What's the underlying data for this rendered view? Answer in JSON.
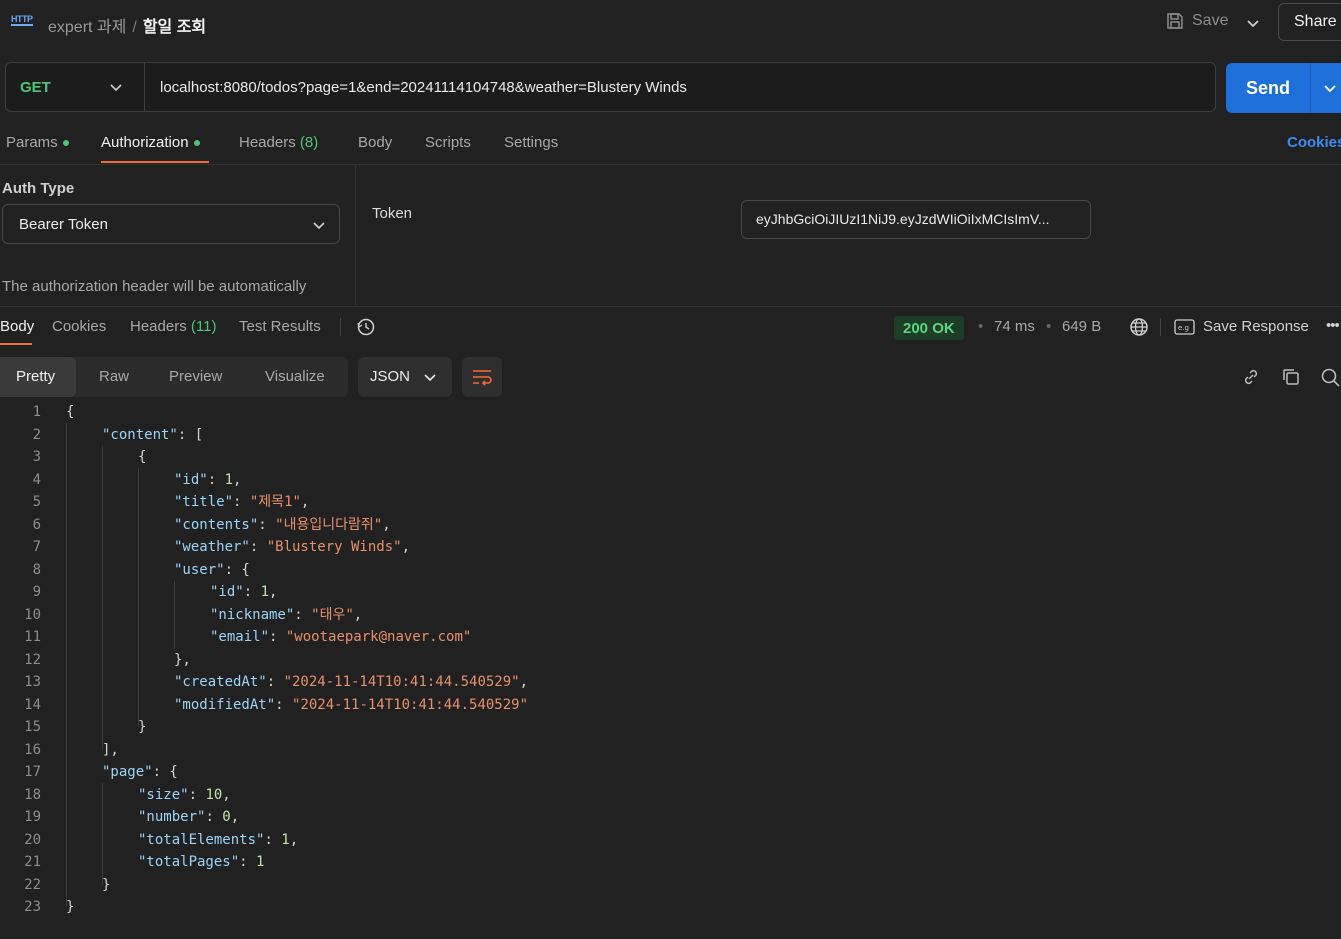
{
  "header": {
    "breadcrumb_collection": "expert 과제",
    "breadcrumb_separator": "/",
    "breadcrumb_request": "할일 조회",
    "save_label": "Save",
    "share_label": "Share"
  },
  "request": {
    "method": "GET",
    "url": "localhost:8080/todos?page=1&end=20241114104748&weather=Blustery Winds",
    "send_label": "Send"
  },
  "request_tabs": {
    "params": "Params",
    "authorization": "Authorization",
    "headers": "Headers",
    "headers_count": "(8)",
    "body": "Body",
    "scripts": "Scripts",
    "settings": "Settings",
    "cookies": "Cookies"
  },
  "auth": {
    "type_label": "Auth Type",
    "type_value": "Bearer Token",
    "note": "The authorization header will be automatically",
    "token_label": "Token",
    "token_value": "eyJhbGciOiJIUzI1NiJ9.eyJzdWIiOiIxMCIsImV..."
  },
  "response_tabs": {
    "body": "Body",
    "cookies": "Cookies",
    "headers": "Headers",
    "headers_count": "(11)",
    "test_results": "Test Results"
  },
  "response_meta": {
    "status": "200 OK",
    "time": "74 ms",
    "size": "649 B",
    "save_response": "Save Response",
    "status_color": "#5bd47f"
  },
  "view": {
    "pretty": "Pretty",
    "raw": "Raw",
    "preview": "Preview",
    "visualize": "Visualize",
    "format": "JSON"
  },
  "code_lines": [
    {
      "n": "1",
      "t": [
        [
          "p",
          "{"
        ]
      ]
    },
    {
      "n": "2",
      "t": [
        [
          "k",
          "\"content\""
        ],
        [
          "p",
          ": ["
        ]
      ]
    },
    {
      "n": "3",
      "t": [
        [
          "p",
          "{"
        ]
      ]
    },
    {
      "n": "4",
      "t": [
        [
          "k",
          "\"id\""
        ],
        [
          "p",
          ": "
        ],
        [
          "n",
          "1"
        ],
        [
          "p",
          ","
        ]
      ]
    },
    {
      "n": "5",
      "t": [
        [
          "k",
          "\"title\""
        ],
        [
          "p",
          ": "
        ],
        [
          "s",
          "\"제목1\""
        ],
        [
          "p",
          ","
        ]
      ]
    },
    {
      "n": "6",
      "t": [
        [
          "k",
          "\"contents\""
        ],
        [
          "p",
          ": "
        ],
        [
          "s",
          "\"내용입니다람쥐\""
        ],
        [
          "p",
          ","
        ]
      ]
    },
    {
      "n": "7",
      "t": [
        [
          "k",
          "\"weather\""
        ],
        [
          "p",
          ": "
        ],
        [
          "s",
          "\"Blustery Winds\""
        ],
        [
          "p",
          ","
        ]
      ]
    },
    {
      "n": "8",
      "t": [
        [
          "k",
          "\"user\""
        ],
        [
          "p",
          ": {"
        ]
      ]
    },
    {
      "n": "9",
      "t": [
        [
          "k",
          "\"id\""
        ],
        [
          "p",
          ": "
        ],
        [
          "n",
          "1"
        ],
        [
          "p",
          ","
        ]
      ]
    },
    {
      "n": "10",
      "t": [
        [
          "k",
          "\"nickname\""
        ],
        [
          "p",
          ": "
        ],
        [
          "s",
          "\"태우\""
        ],
        [
          "p",
          ","
        ]
      ]
    },
    {
      "n": "11",
      "t": [
        [
          "k",
          "\"email\""
        ],
        [
          "p",
          ": "
        ],
        [
          "s",
          "\"wootaepark@naver.com\""
        ]
      ]
    },
    {
      "n": "12",
      "t": [
        [
          "p",
          "},"
        ]
      ]
    },
    {
      "n": "13",
      "t": [
        [
          "k",
          "\"createdAt\""
        ],
        [
          "p",
          ": "
        ],
        [
          "s",
          "\"2024-11-14T10:41:44.540529\""
        ],
        [
          "p",
          ","
        ]
      ]
    },
    {
      "n": "14",
      "t": [
        [
          "k",
          "\"modifiedAt\""
        ],
        [
          "p",
          ": "
        ],
        [
          "s",
          "\"2024-11-14T10:41:44.540529\""
        ]
      ]
    },
    {
      "n": "15",
      "t": [
        [
          "p",
          "}"
        ]
      ]
    },
    {
      "n": "16",
      "t": [
        [
          "p",
          "],"
        ]
      ]
    },
    {
      "n": "17",
      "t": [
        [
          "k",
          "\"page\""
        ],
        [
          "p",
          ": {"
        ]
      ]
    },
    {
      "n": "18",
      "t": [
        [
          "k",
          "\"size\""
        ],
        [
          "p",
          ": "
        ],
        [
          "n",
          "10"
        ],
        [
          "p",
          ","
        ]
      ]
    },
    {
      "n": "19",
      "t": [
        [
          "k",
          "\"number\""
        ],
        [
          "p",
          ": "
        ],
        [
          "n",
          "0"
        ],
        [
          "p",
          ","
        ]
      ]
    },
    {
      "n": "20",
      "t": [
        [
          "k",
          "\"totalElements\""
        ],
        [
          "p",
          ": "
        ],
        [
          "n",
          "1"
        ],
        [
          "p",
          ","
        ]
      ]
    },
    {
      "n": "21",
      "t": [
        [
          "k",
          "\"totalPages\""
        ],
        [
          "p",
          ": "
        ],
        [
          "n",
          "1"
        ]
      ]
    },
    {
      "n": "22",
      "t": [
        [
          "p",
          "}"
        ]
      ]
    },
    {
      "n": "23",
      "t": [
        [
          "p",
          "}"
        ]
      ]
    }
  ]
}
